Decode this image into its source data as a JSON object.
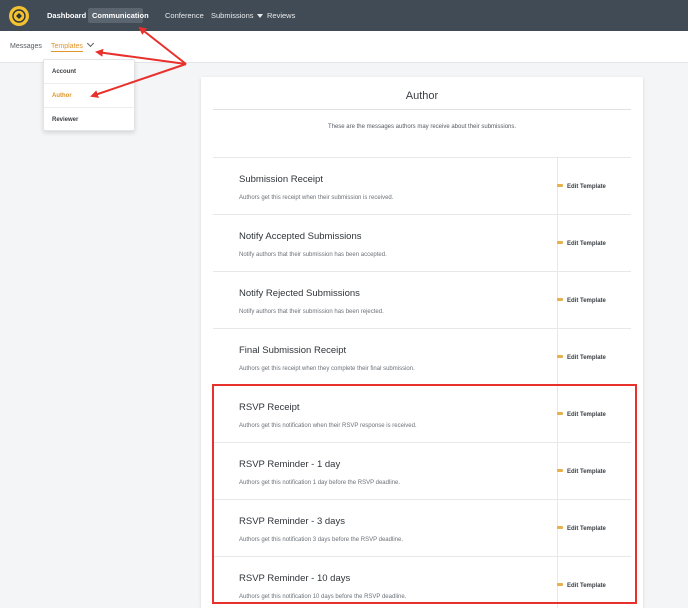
{
  "topnav": {
    "items": [
      {
        "label": "Dashboard"
      },
      {
        "label": "Communication"
      },
      {
        "label": "Conference"
      },
      {
        "label": "Submissions"
      },
      {
        "label": "Reviews"
      }
    ],
    "active": "Communication"
  },
  "subnav": {
    "items": [
      {
        "label": "Messages"
      },
      {
        "label": "Templates"
      }
    ],
    "active": "Templates"
  },
  "dropdown": {
    "items": [
      {
        "label": "Account"
      },
      {
        "label": "Author"
      },
      {
        "label": "Reviewer"
      }
    ],
    "selected": "Author"
  },
  "card": {
    "title": "Author",
    "description": "These are the messages authors may receive about their submissions.",
    "rows": [
      {
        "title": "Submission Receipt",
        "description": "Authors get this receipt when their submission is received.",
        "action": "Edit Template"
      },
      {
        "title": "Notify Accepted Submissions",
        "description": "Notify authors that their submission has been accepted.",
        "action": "Edit Template"
      },
      {
        "title": "Notify Rejected Submissions",
        "description": "Notify authors that their submission has been rejected.",
        "action": "Edit Template"
      },
      {
        "title": "Final Submission Receipt",
        "description": "Authors get this receipt when they complete their final submission.",
        "action": "Edit Template"
      },
      {
        "title": "RSVP Receipt",
        "description": "Authors get this notification when their RSVP response is received.",
        "action": "Edit Template"
      },
      {
        "title": "RSVP Reminder - 1 day",
        "description": "Authors get this notification 1 day before the RSVP deadline.",
        "action": "Edit Template"
      },
      {
        "title": "RSVP Reminder - 3 days",
        "description": "Authors get this notification 3 days before the RSVP deadline.",
        "action": "Edit Template"
      },
      {
        "title": "RSVP Reminder - 10 days",
        "description": "Authors get this notification 10 days before the RSVP deadline.",
        "action": "Edit Template"
      }
    ]
  },
  "colors": {
    "nav_bg": "#414b55",
    "accent": "#e0952c",
    "annotation": "#e8312c",
    "logo": "#f2c230"
  },
  "icons": [
    "logo-icon",
    "chevron-down-icon",
    "pencil-icon"
  ]
}
